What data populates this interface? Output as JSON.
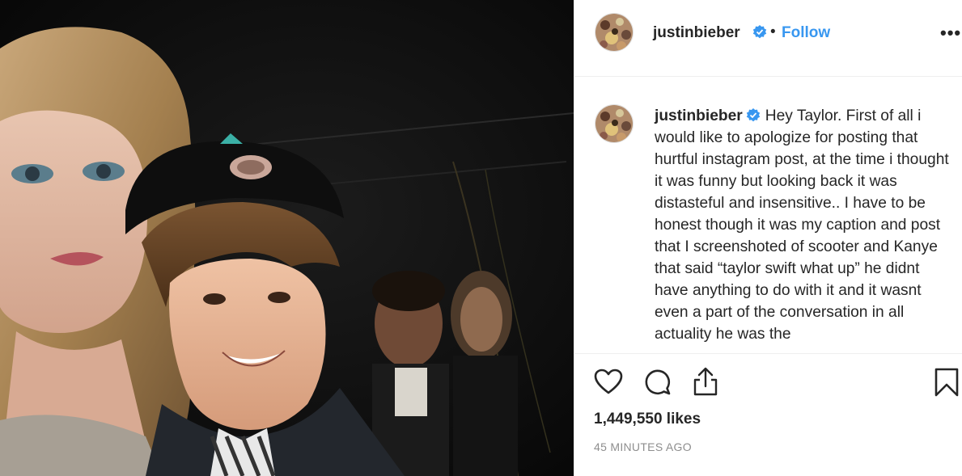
{
  "post": {
    "username": "justinbieber",
    "separator": "•",
    "follow_label": "Follow",
    "more_label": "•••",
    "caption": "Hey Taylor. First of all i would like to apologize for posting that hurtful instagram post, at the time i thought it was funny but looking back it was distasteful and insensitive.. I have to be honest though it was my caption and post that I screenshoted of scooter and Kanye that said “taylor swift what up” he didnt have anything to do with it and it wasnt even a part of the conversation in all actuality he was the",
    "likes": "1,449,550 likes",
    "timestamp": "45 MINUTES AGO"
  },
  "icons": {
    "verified": "verified-badge-icon",
    "like": "heart-icon",
    "comment": "comment-bubble-icon",
    "share": "share-icon",
    "save": "bookmark-icon",
    "more": "more-options-icon"
  },
  "colors": {
    "link_blue": "#3897f0",
    "verified_blue": "#3897f0",
    "text": "#262626",
    "muted": "#8e8e8e"
  }
}
